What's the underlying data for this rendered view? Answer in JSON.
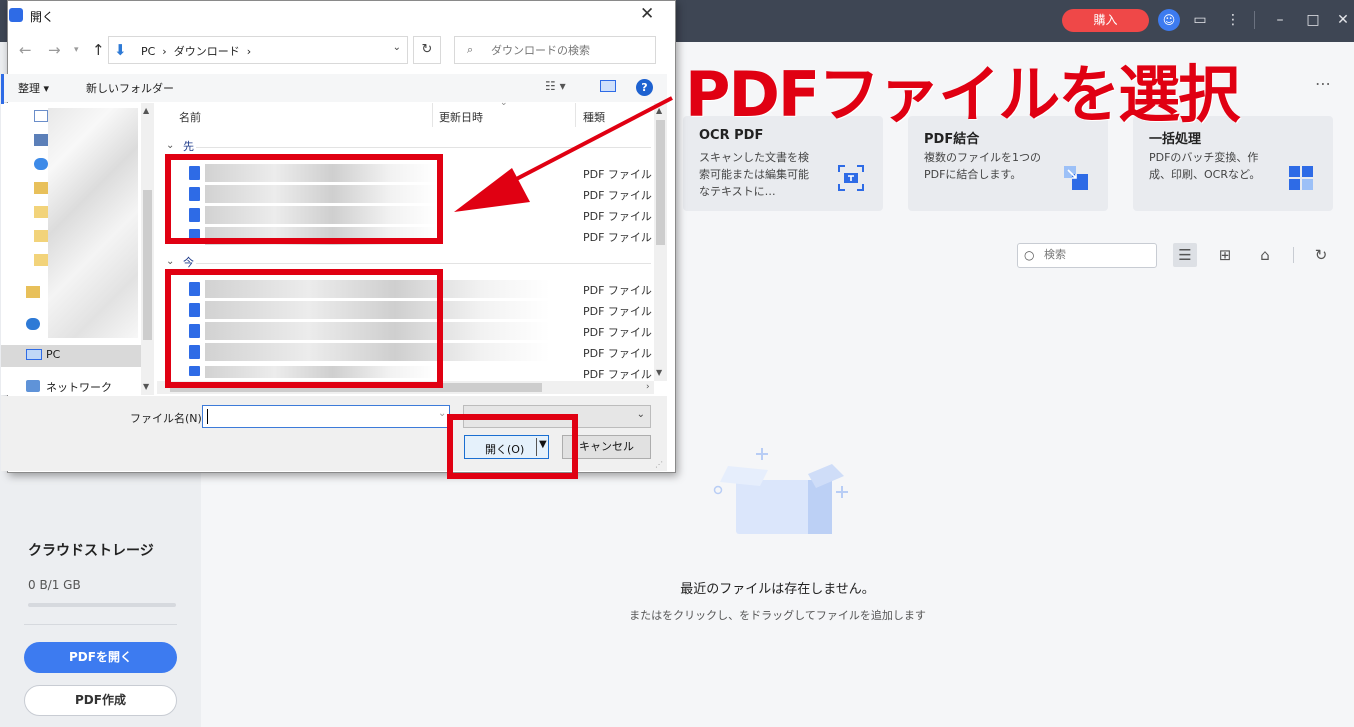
{
  "app": {
    "buy_label": "購入",
    "more_label": "⋯",
    "tools": [
      {
        "title": "OCR PDF",
        "desc": "スキャンした文書を検索可能または編集可能なテキストに…"
      },
      {
        "title": "PDF結合",
        "desc": "複数のファイルを1つのPDFに結合します。"
      },
      {
        "title": "一括処理",
        "desc": "PDFのバッチ変換、作成、印刷、OCRなど。"
      }
    ],
    "search_placeholder": "検索",
    "empty_title": "最近のファイルは存在しません。",
    "empty_sub": "またはをクリックし、をドラッグしてファイルを追加します",
    "sidebar": {
      "cloud_title": "クラウドストレージ",
      "storage": "0 B/1 GB",
      "open_pdf": "PDFを開く",
      "create_pdf": "PDF作成"
    },
    "accent_color": "#3d7bf0",
    "buy_color": "#ef4848"
  },
  "dialog": {
    "title": "開く",
    "address": "PC  ›  ダウンロード  ›",
    "search_placeholder": "ダウンロードの検索",
    "organize": "整理 ▾",
    "new_folder": "新しいフォルダー",
    "nav": {
      "pc": "PC",
      "network": "ネットワーク"
    },
    "columns": {
      "name": "名前",
      "date": "更新日時",
      "type": "種類"
    },
    "groups": [
      {
        "label": "先",
        "files": [
          "PDF ファイル",
          "PDF ファイル",
          "PDF ファイル",
          "PDF ファイル"
        ]
      },
      {
        "label": "今",
        "files": [
          "PDF ファイル",
          "PDF ファイル",
          "PDF ファイル",
          "PDF ファイル",
          "PDF ファイル"
        ]
      }
    ],
    "filename_label": "ファイル名(N):",
    "filename_value": "",
    "open_label": "開く(O)",
    "cancel_label": "キャンセル"
  },
  "annotation": {
    "text": "PDFファイルを選択",
    "color": "#e00012"
  }
}
